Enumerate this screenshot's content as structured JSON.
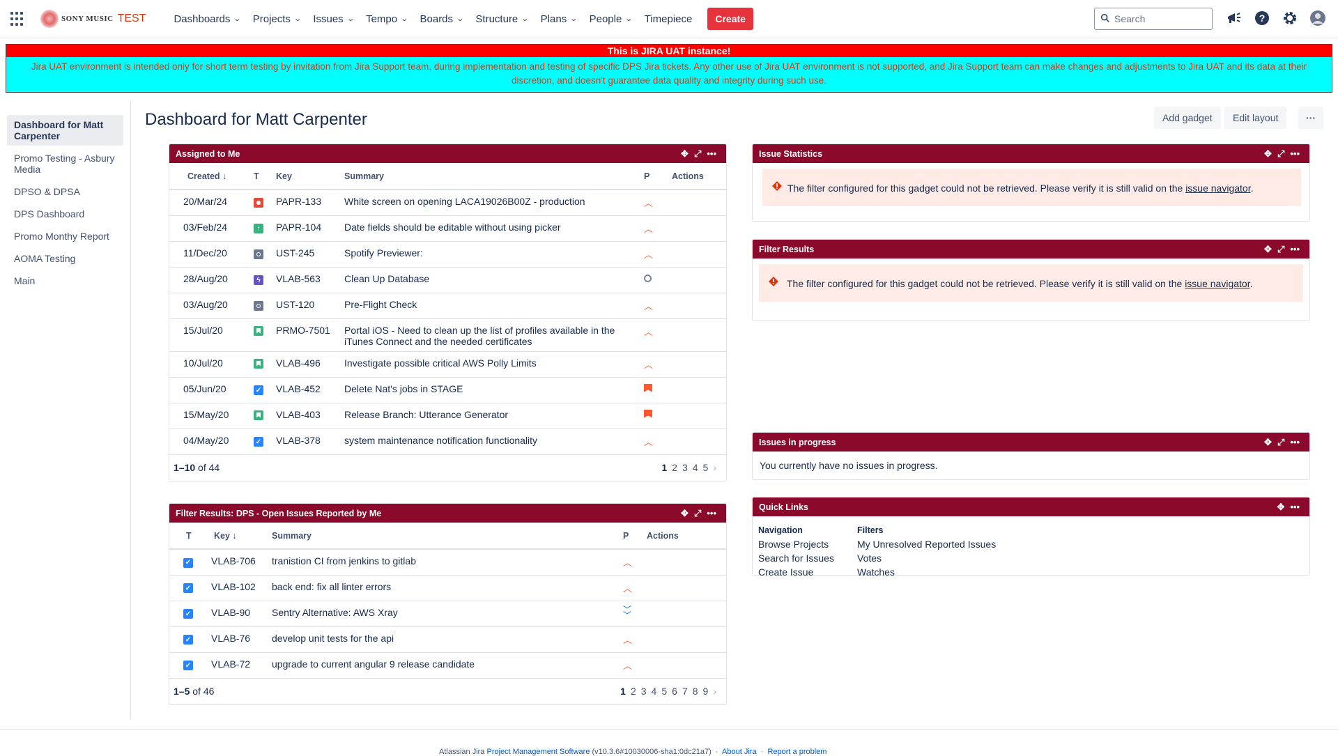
{
  "topnav": {
    "brand": "SONY MUSIC",
    "env": "TEST",
    "items": [
      "Dashboards",
      "Projects",
      "Issues",
      "Tempo",
      "Boards",
      "Structure",
      "Plans",
      "People"
    ],
    "timepiece": "Timepiece",
    "create": "Create",
    "search_placeholder": "Search"
  },
  "banner": {
    "title": "This is JIRA UAT instance!",
    "text": "Jira UAT environment is intended only for short term testing by invitation from Jira Support team, during implementation and testing of specific DPS Jira tickets. Any other use of Jira UAT environment is not supported, and Jira Support team can make changes and adjustments to Jira UAT and its data at their discretion, and doesn't guarantee data quality and integrity during such use."
  },
  "sidebar": {
    "items": [
      "Dashboard for Matt Carpenter",
      "Promo Testing - Asbury Media",
      "DPSO & DPSA",
      "DPS Dashboard",
      "Promo Monthy Report",
      "AOMA Testing",
      "Main"
    ]
  },
  "page": {
    "title": "Dashboard for Matt Carpenter",
    "add_gadget": "Add gadget",
    "edit_layout": "Edit layout",
    "more": "···"
  },
  "assigned": {
    "title": "Assigned to Me",
    "headers": {
      "created": "Created",
      "t": "T",
      "key": "Key",
      "summary": "Summary",
      "p": "P",
      "actions": "Actions"
    },
    "rows": [
      {
        "created": "20/Mar/24",
        "type": "bug",
        "key": "PAPR-133",
        "summary": "White screen on opening LACA19026B00Z - production",
        "prio": "high"
      },
      {
        "created": "03/Feb/24",
        "type": "improvement",
        "key": "PAPR-104",
        "summary": "Date fields should be editable without using picker",
        "prio": "high"
      },
      {
        "created": "11/Dec/20",
        "type": "generic",
        "key": "UST-245",
        "summary": "Spotify Previewer:",
        "prio": "high"
      },
      {
        "created": "28/Aug/20",
        "type": "epic",
        "key": "VLAB-563",
        "summary": "Clean Up Database",
        "prio": "none"
      },
      {
        "created": "03/Aug/20",
        "type": "generic",
        "key": "UST-120",
        "summary": "Pre-Flight Check",
        "prio": "high"
      },
      {
        "created": "15/Jul/20",
        "type": "story",
        "key": "PRMO-7501",
        "summary": "Portal iOS - Need to clean up the list of profiles available in the iTunes Connect and the needed certificates",
        "prio": "high"
      },
      {
        "created": "10/Jul/20",
        "type": "story",
        "key": "VLAB-496",
        "summary": "Investigate possible critical AWS Polly Limits",
        "prio": "high"
      },
      {
        "created": "05/Jun/20",
        "type": "task",
        "key": "VLAB-452",
        "summary": "Delete Nat's jobs in STAGE",
        "prio": "highest"
      },
      {
        "created": "15/May/20",
        "type": "story",
        "key": "VLAB-403",
        "summary": "Release Branch: Utterance Generator",
        "prio": "highest"
      },
      {
        "created": "04/May/20",
        "type": "task",
        "key": "VLAB-378",
        "summary": "system maintenance notification functionality",
        "prio": "high"
      }
    ],
    "count_range": "1–10",
    "count_total": "of 44",
    "pages": [
      "1",
      "2",
      "3",
      "4",
      "5"
    ]
  },
  "filter_dps": {
    "title": "Filter Results: DPS - Open Issues Reported by Me",
    "headers": {
      "t": "T",
      "key": "Key",
      "summary": "Summary",
      "p": "P",
      "actions": "Actions"
    },
    "rows": [
      {
        "type": "task",
        "key": "VLAB-706",
        "summary": "tranistion CI from jenkins to gitlab",
        "prio": "high"
      },
      {
        "type": "task",
        "key": "VLAB-102",
        "summary": "back end: fix all linter errors",
        "prio": "high"
      },
      {
        "type": "task",
        "key": "VLAB-90",
        "summary": "Sentry Alternative: AWS Xray",
        "prio": "lowest"
      },
      {
        "type": "task",
        "key": "VLAB-76",
        "summary": "develop unit tests for the api",
        "prio": "high"
      },
      {
        "type": "task",
        "key": "VLAB-72",
        "summary": "upgrade to current angular 9 release candidate",
        "prio": "high"
      }
    ],
    "count_range": "1–5",
    "count_total": "of 46",
    "pages": [
      "1",
      "2",
      "3",
      "4",
      "5",
      "6",
      "7",
      "8",
      "9"
    ]
  },
  "issue_stats": {
    "title": "Issue Statistics",
    "error": "The filter configured for this gadget could not be retrieved. Please verify it is still valid on the",
    "link": "issue navigator",
    "end": "."
  },
  "filter_results": {
    "title": "Filter Results",
    "error": "The filter configured for this gadget could not be retrieved. Please verify it is still valid on the",
    "link": "issue navigator",
    "end": "."
  },
  "in_progress": {
    "title": "Issues in progress",
    "text": "You currently have no issues in progress."
  },
  "quick_links": {
    "title": "Quick Links",
    "nav_head": "Navigation",
    "nav": [
      "Browse Projects",
      "Search for Issues",
      "Create Issue"
    ],
    "filters_head": "Filters",
    "filters": [
      "My Unresolved Reported Issues",
      "Votes",
      "Watches"
    ]
  },
  "footer": {
    "text": "Atlassian Jira",
    "link": "Project Management Software",
    "version": "(v10.3.6#10030006-sha1:0dc21a7)",
    "about": "About Jira",
    "report": "Report a problem"
  },
  "colors": {
    "gadget_header": "#8b0a2c",
    "create": "#e5323b",
    "banner_red": "#ff0000",
    "banner_cyan": "#00ffff"
  }
}
